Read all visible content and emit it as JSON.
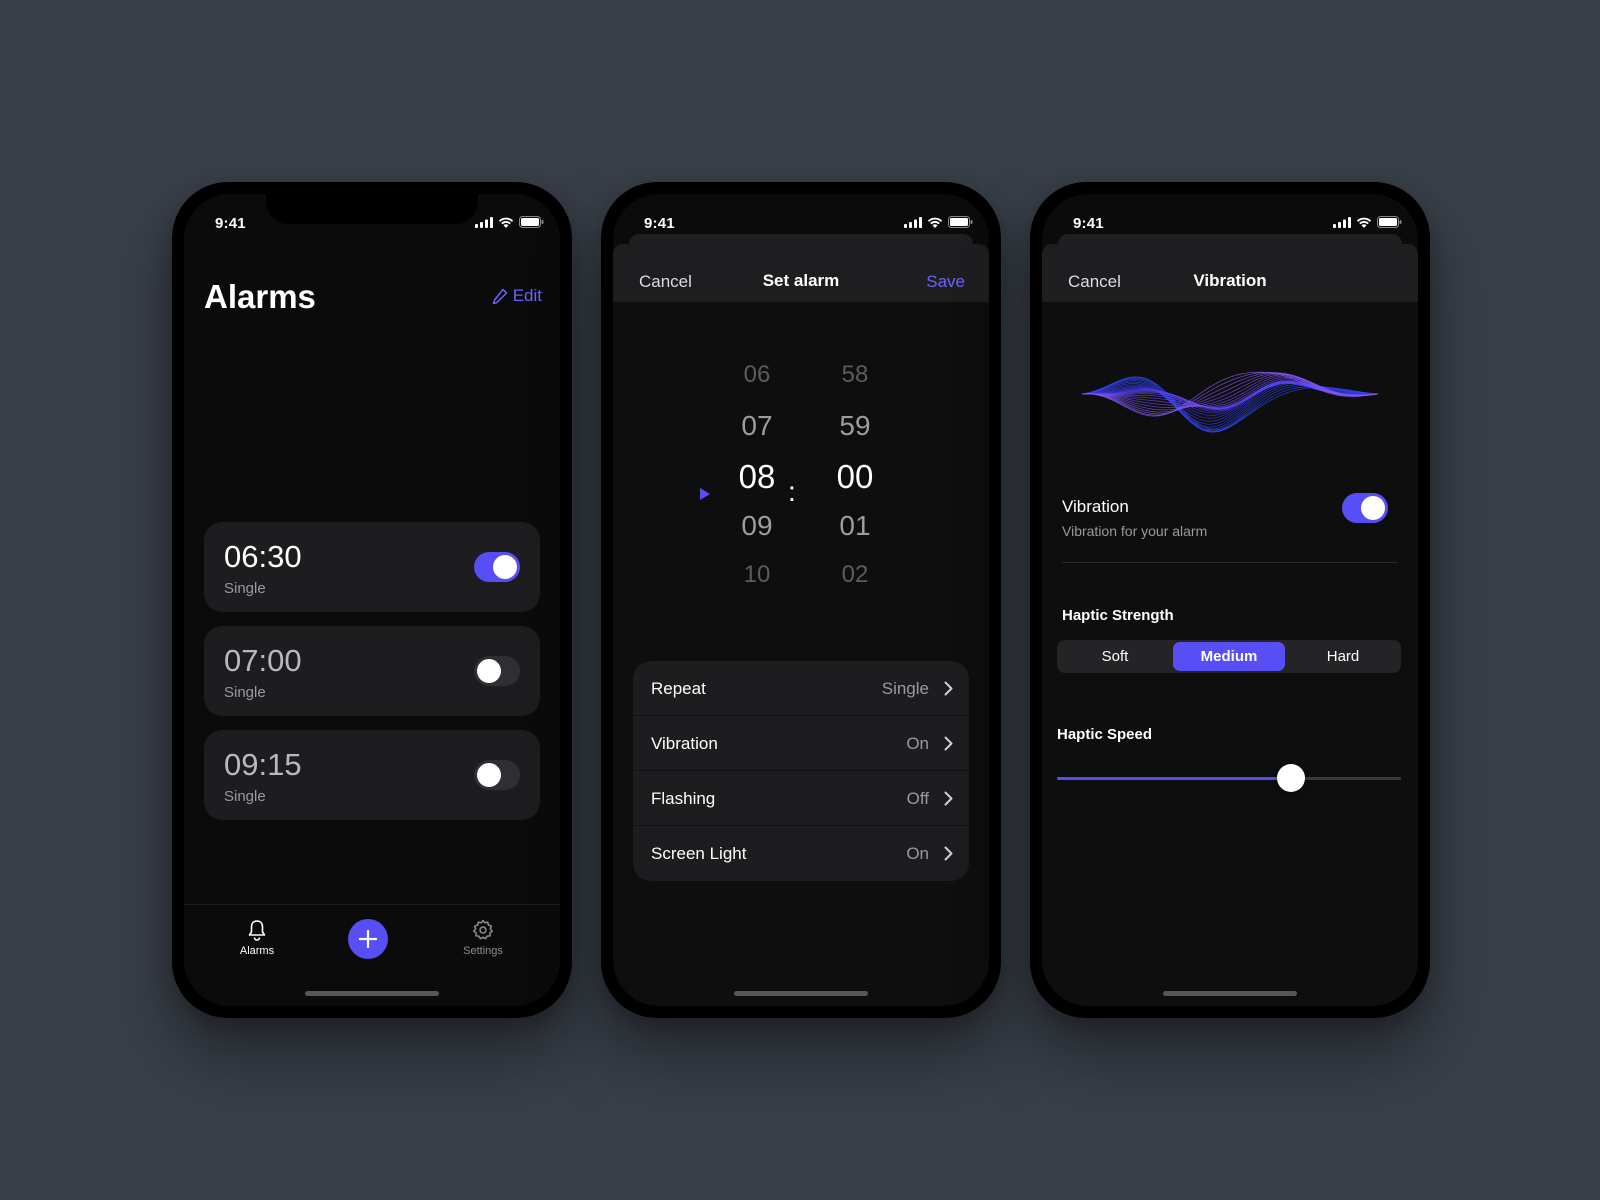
{
  "colors": {
    "accent": "#574ef5",
    "background": "#393f48"
  },
  "phone1": {
    "status_time": "9:41",
    "title": "Alarms",
    "edit_label": "Edit",
    "alarms": [
      {
        "time": "06:30",
        "repeat": "Single",
        "enabled": true
      },
      {
        "time": "07:00",
        "repeat": "Single",
        "enabled": false
      },
      {
        "time": "09:15",
        "repeat": "Single",
        "enabled": false
      }
    ],
    "tabs": [
      {
        "label": "Alarms",
        "icon": "bell-icon",
        "active": true
      },
      {
        "label": "Settings",
        "icon": "gear-icon",
        "active": false
      }
    ],
    "fab_icon": "plus-icon"
  },
  "phone2": {
    "status_time": "9:41",
    "cancel": "Cancel",
    "title": "Set alarm",
    "save": "Save",
    "hours": [
      "06",
      "07",
      "08",
      "09",
      "10"
    ],
    "minutes": [
      "58",
      "59",
      "00",
      "01",
      "02"
    ],
    "colon": ":",
    "settings": [
      {
        "label": "Repeat",
        "value": "Single"
      },
      {
        "label": "Vibration",
        "value": "On"
      },
      {
        "label": "Flashing",
        "value": "Off"
      },
      {
        "label": "Screen Light",
        "value": "On"
      }
    ]
  },
  "phone3": {
    "status_time": "9:41",
    "cancel": "Cancel",
    "title": "Vibration",
    "vibration_label": "Vibration",
    "vibration_sub": "Vibration for your alarm",
    "vibration_enabled": true,
    "haptic_strength_label": "Haptic Strength",
    "strength_options": [
      "Soft",
      "Medium",
      "Hard"
    ],
    "strength_selected": "Medium",
    "haptic_speed_label": "Haptic Speed",
    "haptic_speed_value": 0.68
  }
}
